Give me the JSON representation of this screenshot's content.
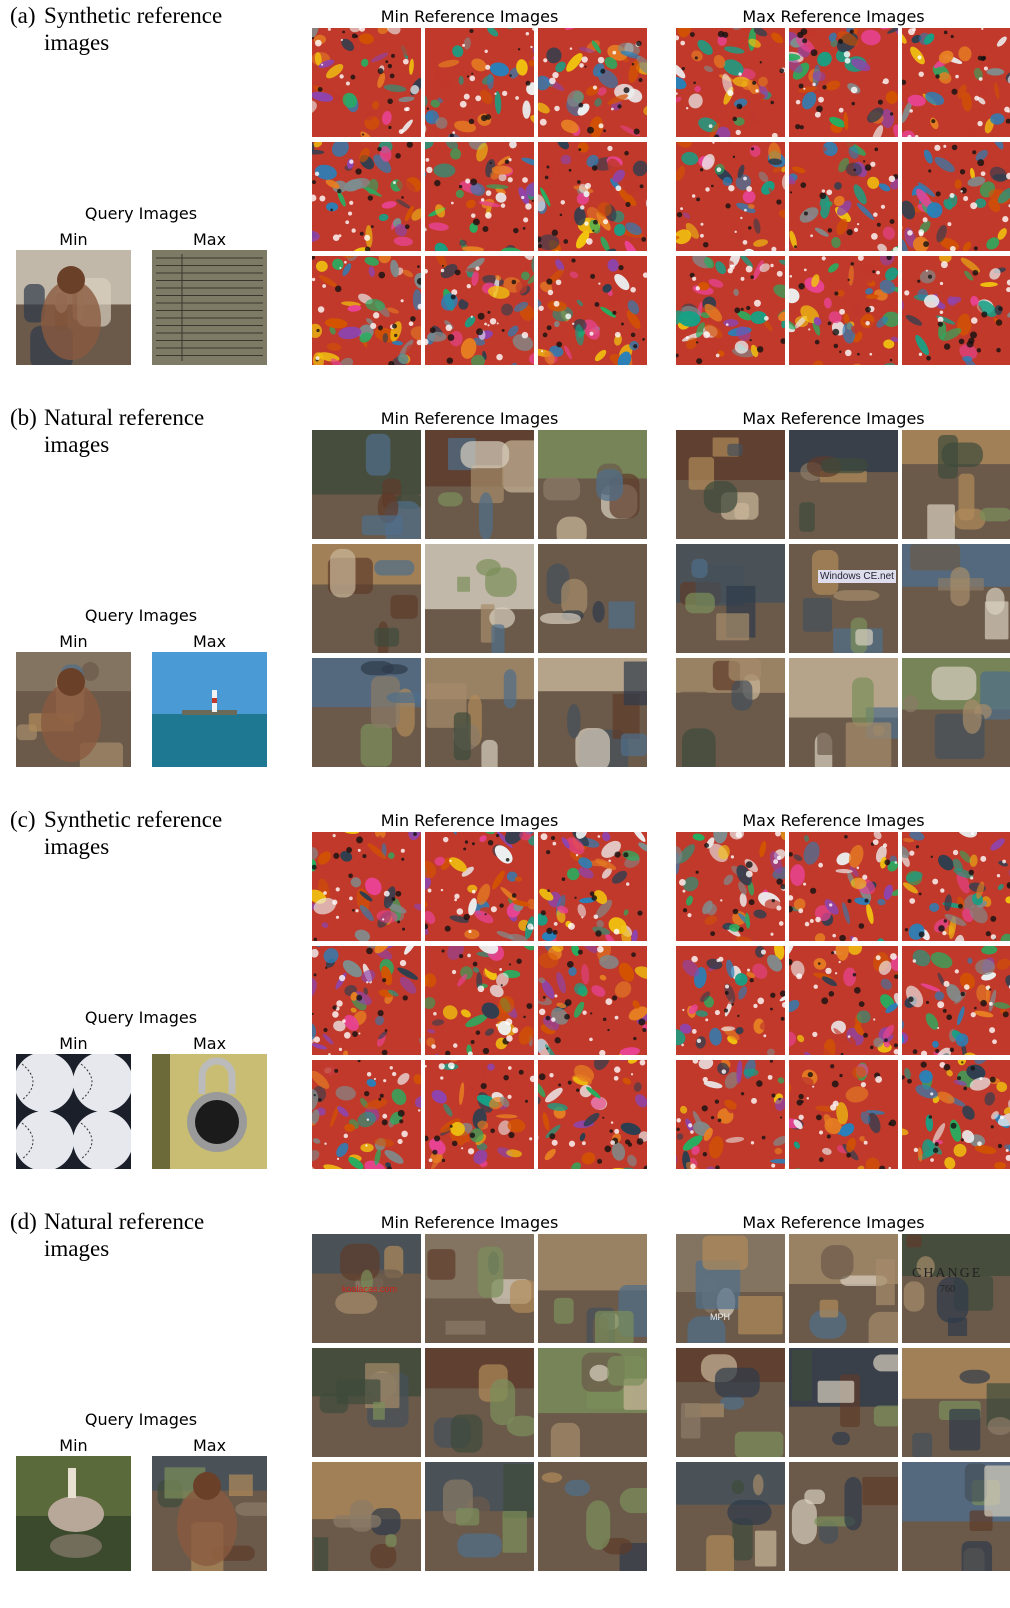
{
  "panels": [
    {
      "tag": "(a)",
      "label_line1": "Synthetic reference",
      "label_line2": "images",
      "query_title": "Query Images",
      "query_min_label": "Min",
      "query_max_label": "Max",
      "min_ref_title": "Min Reference Images",
      "max_ref_title": "Max Reference Images",
      "query_min_image": "people-with-paddle-photo",
      "query_max_image": "printed-form-photo",
      "min_ref_style": "synthetic-texture",
      "max_ref_style": "synthetic-texture"
    },
    {
      "tag": "(b)",
      "label_line1": "Natural reference",
      "label_line2": "images",
      "query_title": "Query Images",
      "query_min_label": "Min",
      "query_max_label": "Max",
      "min_ref_title": "Min Reference Images",
      "max_ref_title": "Max Reference Images",
      "query_min_image": "woman-with-bassoon-photo",
      "query_max_image": "sea-lighthouse-photo",
      "min_ref_style": "natural-photo",
      "max_ref_style": "natural-photo"
    },
    {
      "tag": "(c)",
      "label_line1": "Synthetic reference",
      "label_line2": "images",
      "query_title": "Query Images",
      "query_min_label": "Min",
      "query_max_label": "Max",
      "min_ref_title": "Min Reference Images",
      "max_ref_title": "Max Reference Images",
      "query_min_image": "baseballs-photo",
      "query_max_image": "combination-lock-photo",
      "min_ref_style": "synthetic-texture",
      "max_ref_style": "synthetic-texture"
    },
    {
      "tag": "(d)",
      "label_line1": "Natural reference",
      "label_line2": "images",
      "query_title": "Query Images",
      "query_min_label": "Min",
      "query_max_label": "Max",
      "min_ref_title": "Min Reference Images",
      "max_ref_title": "Max Reference Images",
      "query_min_image": "pelican-photo",
      "query_max_image": "dog-statue-photo",
      "min_ref_style": "natural-photo",
      "max_ref_style": "natural-photo"
    }
  ],
  "panel_d_text": {
    "ocarina_caption": "koolacas.com",
    "gauge_caption": "MPH",
    "barometer_word": "CHANGE",
    "barometer_number": "760",
    "pda_caption": "Windows CE.net"
  },
  "colors": {
    "synthetic_palette": [
      "#c0392b",
      "#e67e22",
      "#f1c40f",
      "#27ae60",
      "#2980b9",
      "#8e44ad",
      "#16a085",
      "#d35400",
      "#7f8c8d",
      "#ecf0f1",
      "#2c3e50",
      "#e84393"
    ]
  }
}
